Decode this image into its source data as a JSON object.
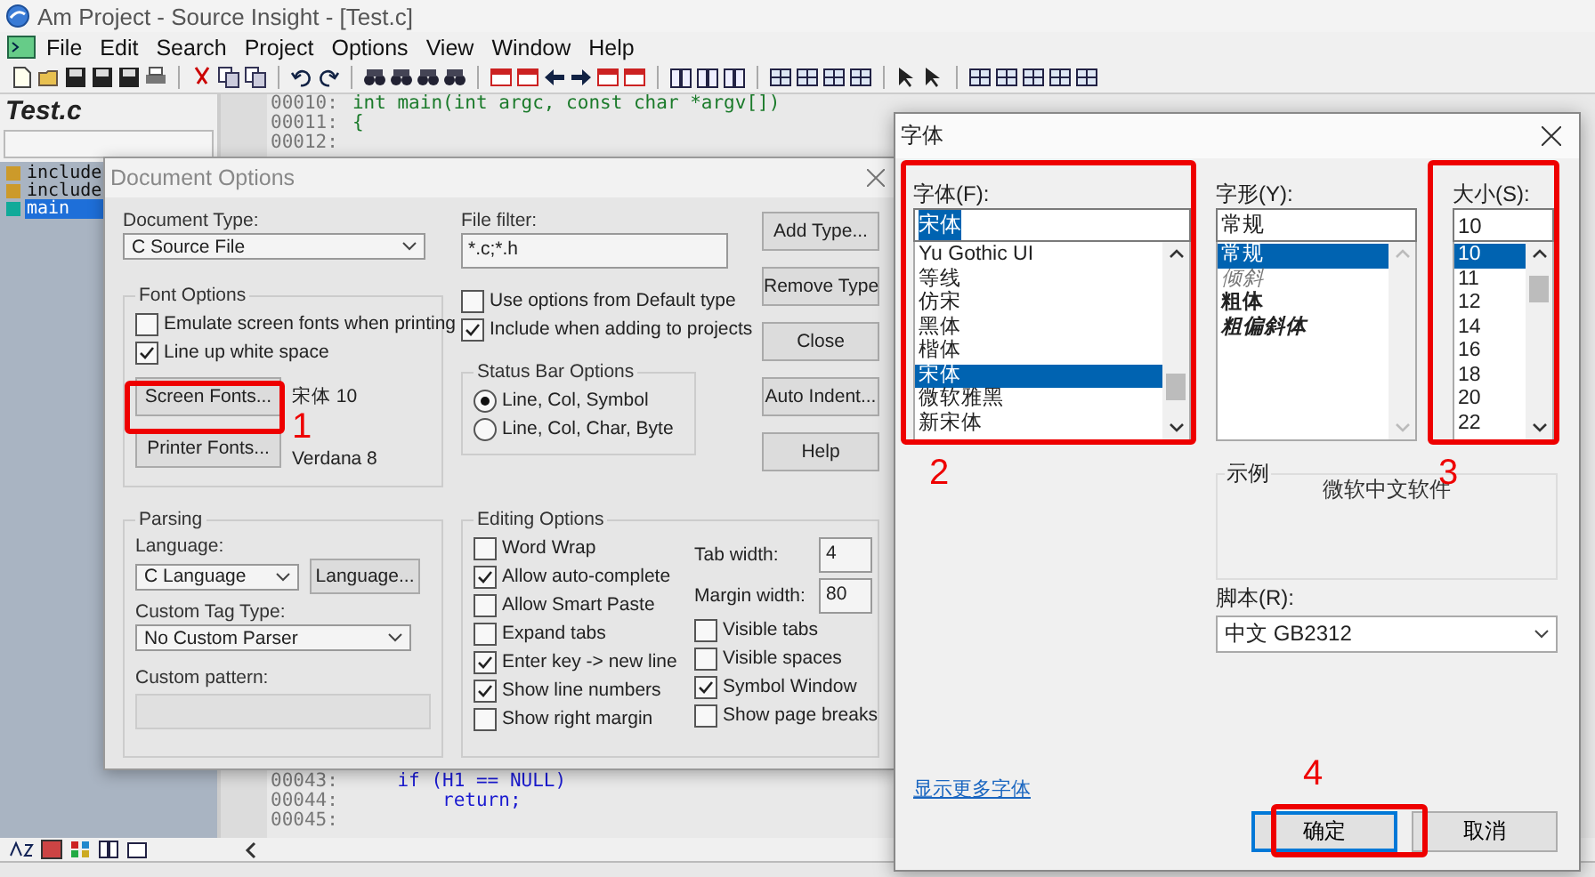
{
  "window": {
    "title": "Am Project - Source Insight - [Test.c]"
  },
  "menu": [
    "File",
    "Edit",
    "Search",
    "Project",
    "Options",
    "View",
    "Window",
    "Help"
  ],
  "symbol_panel": {
    "title": "Test.c",
    "symbols": [
      {
        "label": "include",
        "selected": false
      },
      {
        "label": "include",
        "selected": false
      },
      {
        "label": "main",
        "selected": true
      }
    ]
  },
  "editor": {
    "top_lines": [
      {
        "number": "00010:",
        "code": "int main(int argc, const char *argv[])"
      },
      {
        "number": "00011:",
        "code": "{"
      },
      {
        "number": "00012:"
      }
    ],
    "bottom_lines": [
      {
        "number": "00043:",
        "code": "    if (H1 == NULL)"
      },
      {
        "number": "00044:",
        "code": "        return;"
      },
      {
        "number": "00045:"
      }
    ]
  },
  "document_options": {
    "title": "Document Options",
    "document_type": {
      "label": "Document Type:",
      "value": "C Source File"
    },
    "file_filter": {
      "label": "File filter:",
      "value": "*.c;*.h"
    },
    "buttons": [
      "Add Type...",
      "Remove Type",
      "Close",
      "Auto Indent...",
      "Help"
    ],
    "font_options": {
      "title": "Font Options",
      "checkboxes": [
        {
          "label": "Emulate screen fonts when printing",
          "checked": false
        },
        {
          "label": "Line up white space",
          "checked": true
        }
      ],
      "fonts": [
        {
          "button": "Screen Fonts...",
          "font": "宋体 10"
        },
        {
          "button": "Printer Fonts...",
          "font": "Verdana 8"
        }
      ]
    },
    "type_checkboxes": [
      {
        "label": "Use options from Default type",
        "checked": false
      },
      {
        "label": "Include when adding to projects",
        "checked": true
      }
    ],
    "status_bar_options": {
      "title": "Status Bar Options",
      "radios": [
        {
          "label": "Line, Col, Symbol",
          "selected": true
        },
        {
          "label": "Line, Col, Char, Byte",
          "selected": false
        }
      ]
    },
    "parsing": {
      "title": "Parsing",
      "language": {
        "label": "Language:",
        "value": "C Language",
        "button": "Language..."
      },
      "custom_tag_type": {
        "label": "Custom Tag Type:",
        "value": "No Custom Parser"
      },
      "custom_pattern": {
        "label": "Custom pattern:",
        "disabled": true
      }
    },
    "editing_options": {
      "title": "Editing Options",
      "left": [
        {
          "label": "Word Wrap",
          "checked": false
        },
        {
          "label": "Allow auto-complete",
          "checked": true
        },
        {
          "label": "Allow Smart Paste",
          "checked": false
        },
        {
          "label": "Expand tabs",
          "checked": false
        },
        {
          "label": "Enter key -> new line",
          "checked": true
        },
        {
          "label": "Show line numbers",
          "checked": true
        },
        {
          "label": "Show right margin",
          "checked": false
        }
      ],
      "tab_width": {
        "label": "Tab width:",
        "value": "4"
      },
      "margin_width": {
        "label": "Margin width:",
        "value": "80"
      },
      "right": [
        {
          "label": "Visible tabs",
          "checked": false
        },
        {
          "label": "Visible spaces",
          "checked": false
        },
        {
          "label": "Symbol Window",
          "checked": true
        },
        {
          "label": "Show page breaks",
          "checked": false
        }
      ]
    }
  },
  "font_dialog": {
    "title": "字体",
    "font": {
      "label": "字体(F):",
      "value": "宋体",
      "items": [
        {
          "label": "Yu Gothic UI",
          "selected": false
        },
        {
          "label": "等线",
          "selected": false
        },
        {
          "label": "仿宋",
          "selected": false
        },
        {
          "label": "黑体",
          "selected": false
        },
        {
          "label": "楷体",
          "selected": false
        },
        {
          "label": "宋体",
          "selected": true
        },
        {
          "label": "微软雅黑",
          "selected": false
        },
        {
          "label": "新宋体",
          "selected": false
        }
      ]
    },
    "style": {
      "label": "字形(Y):",
      "value": "常规",
      "items": [
        {
          "label": "常规",
          "kind": "regular",
          "selected": true
        },
        {
          "label": "倾斜",
          "kind": "italic",
          "selected": false
        },
        {
          "label": "粗体",
          "kind": "bold",
          "selected": false
        },
        {
          "label": "粗偏斜体",
          "kind": "bold-italic",
          "selected": false
        }
      ]
    },
    "size": {
      "label": "大小(S):",
      "value": "10",
      "items": [
        {
          "label": "10",
          "selected": true
        },
        {
          "label": "11",
          "selected": false
        },
        {
          "label": "12",
          "selected": false
        },
        {
          "label": "14",
          "selected": false
        },
        {
          "label": "16",
          "selected": false
        },
        {
          "label": "18",
          "selected": false
        },
        {
          "label": "20",
          "selected": false
        },
        {
          "label": "22",
          "selected": false
        }
      ]
    },
    "sample": {
      "title": "示例",
      "text": "微软中文软件"
    },
    "script": {
      "label": "脚本(R):",
      "value": "中文 GB2312"
    },
    "more_fonts_link": "显示更多字体",
    "buttons": [
      {
        "label": "确定",
        "default": true
      },
      {
        "label": "取消",
        "default": false
      }
    ]
  },
  "annotations": [
    "1",
    "2",
    "3",
    "4"
  ]
}
